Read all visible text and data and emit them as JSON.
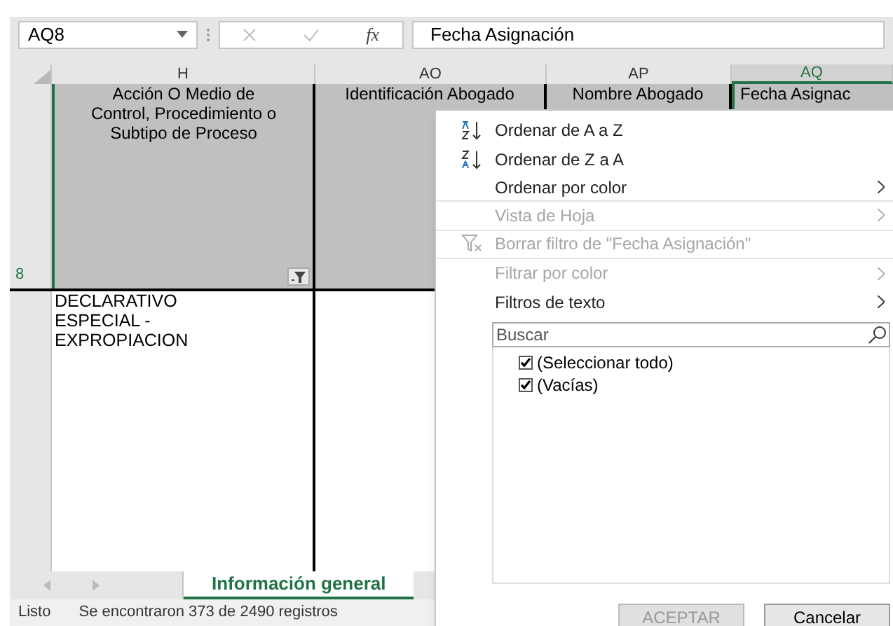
{
  "formula_bar": {
    "name_box": "AQ8",
    "function_label": "fx",
    "formula": "Fecha Asignación"
  },
  "columns": [
    {
      "label": "H",
      "selected": false
    },
    {
      "label": "AO",
      "selected": false
    },
    {
      "label": "AP",
      "selected": false
    },
    {
      "label": "AQ",
      "selected": true
    }
  ],
  "header_row": {
    "number": "8",
    "cells": [
      "Acción O Medio de Control, Procedimiento o Subtipo de Proceso",
      "Identificación Abogado",
      "Nombre Abogado",
      "Fecha Asignac"
    ],
    "filter_active": true
  },
  "data_row": {
    "cells": [
      "DECLARATIVO ESPECIAL - EXPROPIACION"
    ]
  },
  "sheet_tabs": [
    {
      "label": "Información general",
      "selected": true
    }
  ],
  "status_bar": {
    "mode": "Listo",
    "message": "Se encontraron 373 de 2490 registros"
  },
  "filter_menu": {
    "items": [
      {
        "kind": "sort_asc",
        "label": "Ordenar de A a Z",
        "disabled": false,
        "submenu": false
      },
      {
        "kind": "sort_desc",
        "label": "Ordenar de Z a A",
        "disabled": false,
        "submenu": false
      },
      {
        "kind": "plain",
        "label": "Ordenar por color",
        "disabled": false,
        "submenu": true
      },
      {
        "kind": "plain",
        "label": "Vista de Hoja",
        "disabled": true,
        "submenu": true
      },
      {
        "kind": "clear",
        "label": "Borrar filtro de \"Fecha Asignación\"",
        "disabled": true,
        "submenu": false
      },
      {
        "kind": "plain",
        "label": "Filtrar por color",
        "disabled": true,
        "submenu": true
      },
      {
        "kind": "plain",
        "label": "Filtros de texto",
        "disabled": false,
        "submenu": true
      }
    ],
    "search": {
      "placeholder": "Buscar"
    },
    "values": [
      {
        "label": "(Seleccionar todo)",
        "checked": true
      },
      {
        "label": "(Vacías)",
        "checked": true
      }
    ],
    "buttons": [
      {
        "label": "ACEPTAR",
        "disabled": true
      },
      {
        "label": "Cancelar",
        "disabled": false
      }
    ]
  }
}
